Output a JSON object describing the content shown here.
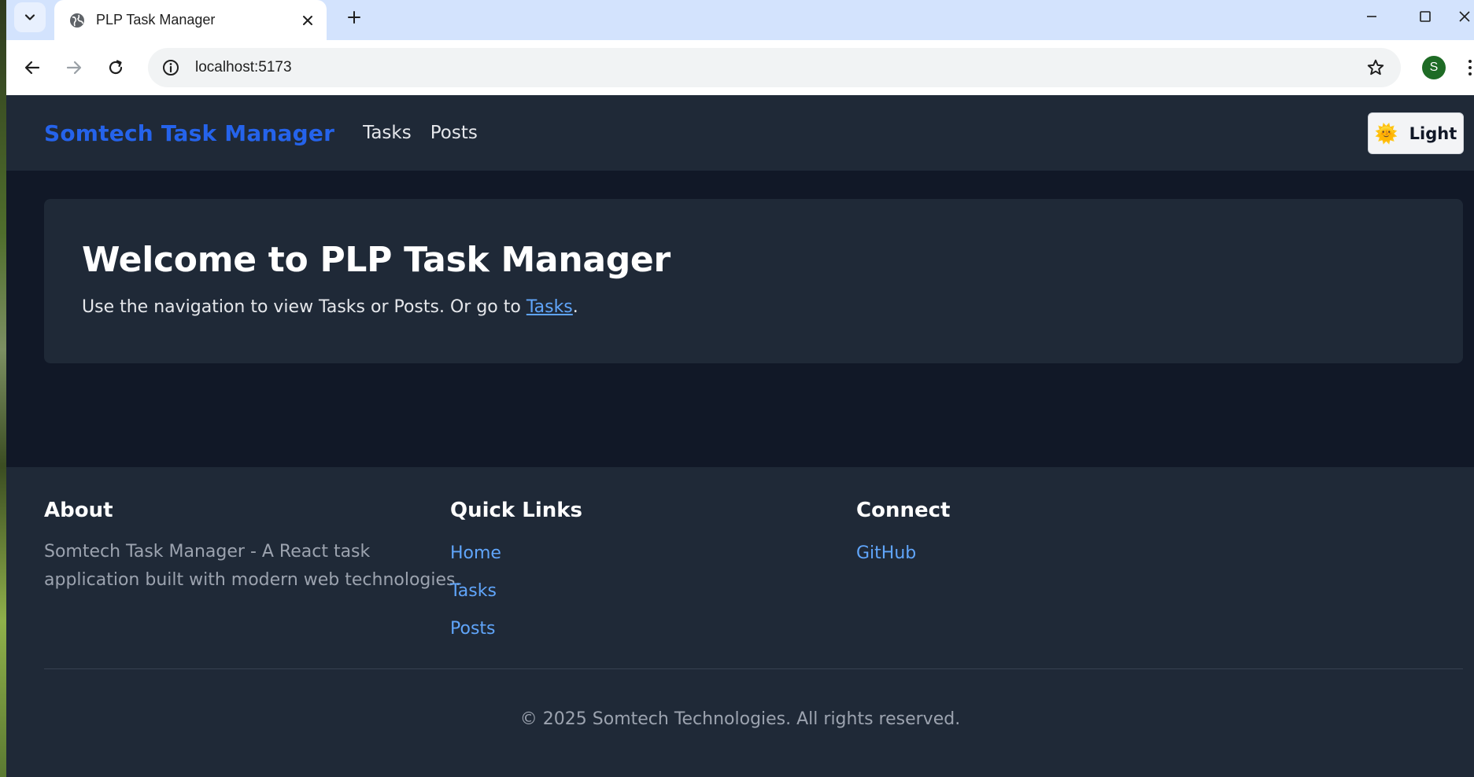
{
  "browser": {
    "tab_title": "PLP Task Manager",
    "url": "localhost:5173",
    "profile_initial": "S"
  },
  "navbar": {
    "brand": "Somtech Task Manager",
    "links": [
      "Tasks",
      "Posts"
    ],
    "theme_icon": "sun-emoji",
    "theme_emoji": "🌞",
    "theme_label": "Light"
  },
  "hero": {
    "title": "Welcome to PLP Task Manager",
    "text_before": "Use the navigation to view Tasks or Posts. Or go to ",
    "link_text": "Tasks",
    "text_after": "."
  },
  "footer": {
    "about_heading": "About",
    "about_text": "Somtech Task Manager - A React task application built with modern web technologies.",
    "quick_links_heading": "Quick Links",
    "quick_links": [
      "Home",
      "Tasks",
      "Posts"
    ],
    "connect_heading": "Connect",
    "connect_links": [
      "GitHub"
    ],
    "copyright": "© 2025 Somtech Technologies. All rights reserved."
  },
  "colors": {
    "brand": "#2563eb",
    "link": "#60a5fa",
    "page_bg": "#111827",
    "panel_bg": "#1f2937"
  }
}
